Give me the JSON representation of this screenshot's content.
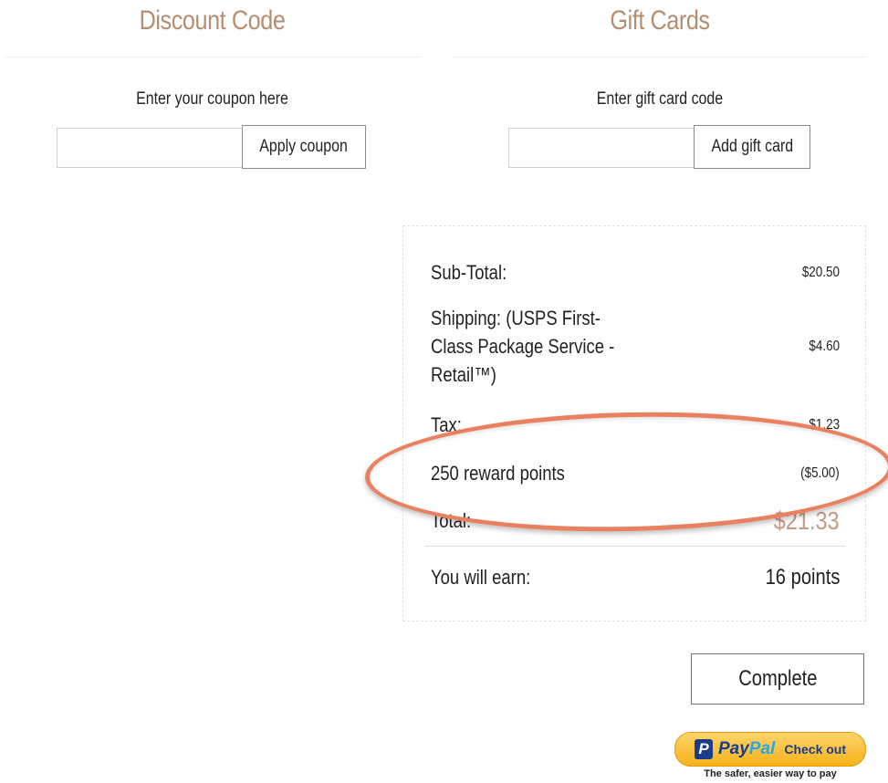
{
  "discount": {
    "title": "Discount Code",
    "caption": "Enter your coupon here",
    "input_value": "",
    "button_label": "Apply coupon"
  },
  "giftcards": {
    "title": "Gift Cards",
    "caption": "Enter gift card code",
    "input_value": "",
    "button_label": "Add gift card"
  },
  "summary": {
    "subtotal_label": "Sub-Total:",
    "subtotal_value": "$20.50",
    "shipping_label_line1": "Shipping: (USPS First-",
    "shipping_label_line2": "Class Package Service -",
    "shipping_label_line3": "Retail™)",
    "shipping_value": "$4.60",
    "tax_label": "Tax:",
    "tax_value": "$1.23",
    "reward_label": "250 reward points",
    "reward_value": "($5.00)",
    "total_label": "Total:",
    "total_value": "$21.33",
    "earn_label": "You will earn:",
    "earn_value": "16 points"
  },
  "actions": {
    "complete_label": "Complete",
    "paypal_brand_1": "Pay",
    "paypal_brand_2": "Pal",
    "paypal_icon": "P",
    "paypal_cta": "Check out",
    "paypal_tagline": "The safer, easier way to pay"
  },
  "colors": {
    "accent_title": "#b78d72",
    "highlight_oval": "#e9805f",
    "paypal_yellow": "#f6b21a"
  }
}
